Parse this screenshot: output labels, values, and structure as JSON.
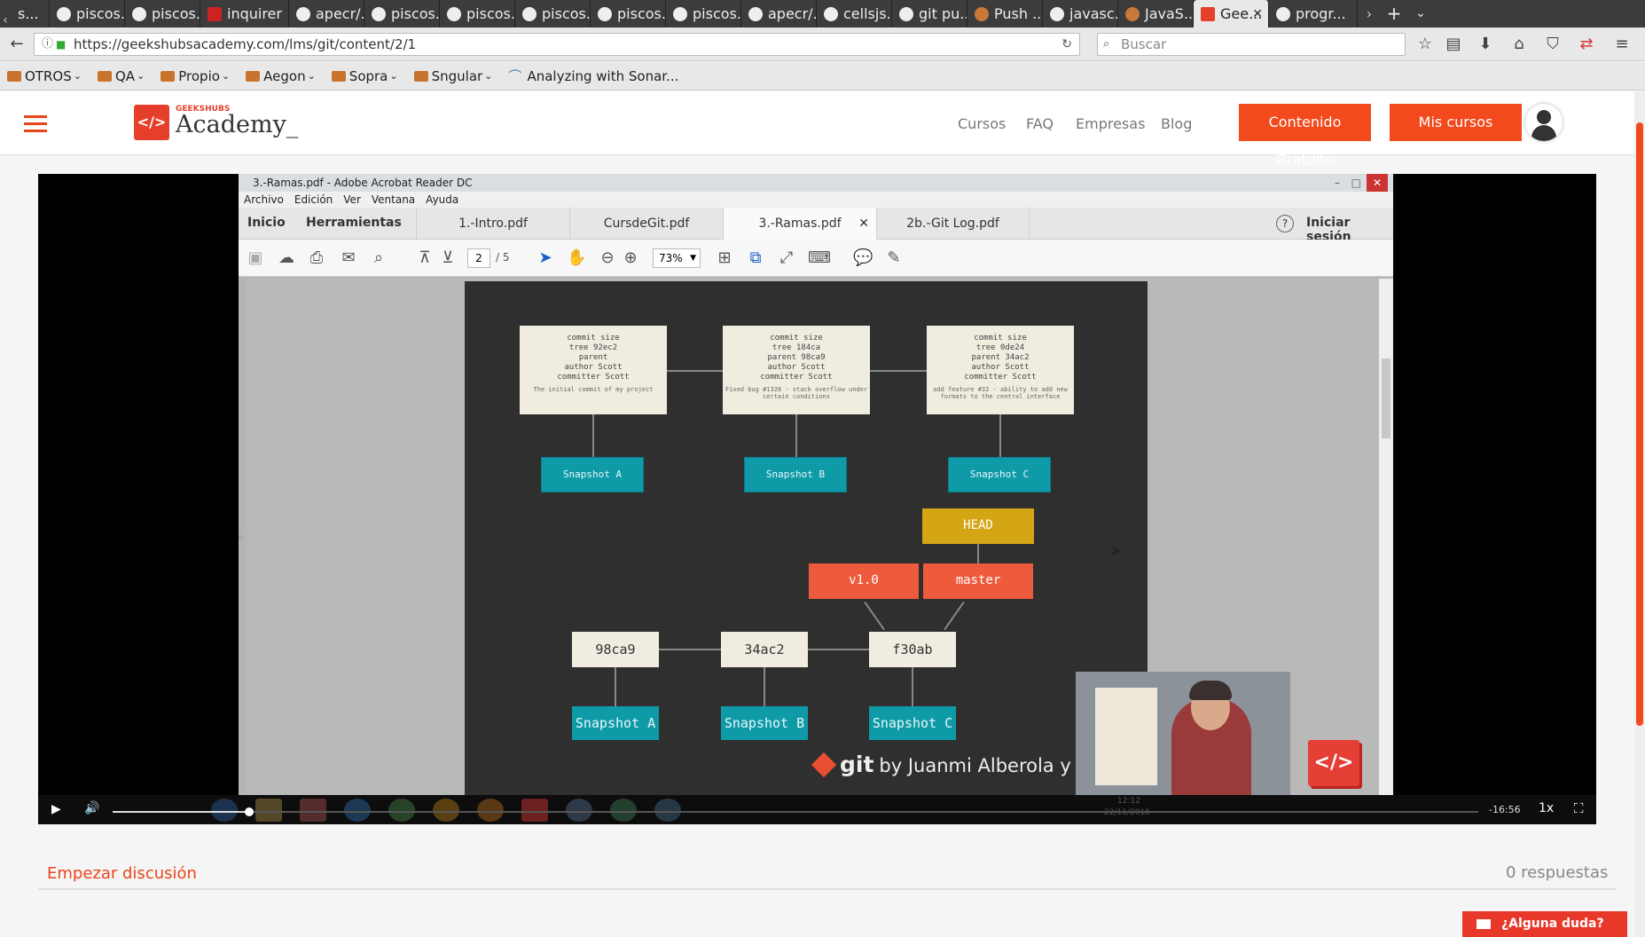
{
  "browser": {
    "tabs": [
      {
        "label": "s..."
      },
      {
        "label": "piscos..."
      },
      {
        "label": "piscos..."
      },
      {
        "label": "inquirer"
      },
      {
        "label": "apecr/..."
      },
      {
        "label": "piscos..."
      },
      {
        "label": "piscos..."
      },
      {
        "label": "piscos..."
      },
      {
        "label": "piscos..."
      },
      {
        "label": "piscos..."
      },
      {
        "label": "apecr/..."
      },
      {
        "label": "cellsjs..."
      },
      {
        "label": "git pu..."
      },
      {
        "label": "Push ..."
      },
      {
        "label": "javasc..."
      },
      {
        "label": "JavaS..."
      },
      {
        "label": "Gee..."
      },
      {
        "label": "progr..."
      }
    ],
    "url": "https://geekshubsacademy.com/lms/git/content/2/1",
    "search_placeholder": "Buscar",
    "bookmarks": [
      {
        "label": "OTROS"
      },
      {
        "label": "QA"
      },
      {
        "label": "Propio"
      },
      {
        "label": "Aegon"
      },
      {
        "label": "Sopra"
      },
      {
        "label": "Sngular"
      },
      {
        "label": "Analyzing with Sonar..."
      }
    ]
  },
  "site": {
    "logo_small": "GEEKSHUBS",
    "logo_text": "Academy_",
    "logo_mark": "</>",
    "nav": [
      {
        "label": "Cursos"
      },
      {
        "label": "FAQ"
      },
      {
        "label": "Empresas"
      },
      {
        "label": "Blog"
      }
    ],
    "btn_free": "Contenido Gratuito",
    "btn_courses": "Mis cursos"
  },
  "acrobat": {
    "title": "3.-Ramas.pdf - Adobe Acrobat Reader DC",
    "menu": [
      {
        "label": "Archivo"
      },
      {
        "label": "Edición"
      },
      {
        "label": "Ver"
      },
      {
        "label": "Ventana"
      },
      {
        "label": "Ayuda"
      }
    ],
    "home": "Inicio",
    "tools": "Herramientas",
    "doc_tabs": [
      {
        "label": "1.-Intro.pdf"
      },
      {
        "label": "CursdeGit.pdf"
      },
      {
        "label": "3.-Ramas.pdf"
      },
      {
        "label": "2b.-Git Log.pdf"
      }
    ],
    "signin": "Iniciar sesión",
    "page_current": "2",
    "page_total": "/ 5",
    "zoom": "73%"
  },
  "slide": {
    "commits": [
      {
        "rows": [
          "commit  size",
          "tree  92ec2",
          "parent",
          "author  Scott",
          "committer  Scott"
        ],
        "msg": "The initial commit of my project"
      },
      {
        "rows": [
          "commit  size",
          "tree  184ca",
          "parent  98ca9",
          "author  Scott",
          "committer  Scott"
        ],
        "msg": "Fixed bug #1328 - stack overflow under certain conditions"
      },
      {
        "rows": [
          "commit  size",
          "tree  0de24",
          "parent  34ac2",
          "author  Scott",
          "committer  Scott"
        ],
        "msg": "add feature #32 - ability to add new formats to the central interface"
      }
    ],
    "snapshots_top": [
      "Snapshot A",
      "Snapshot B",
      "Snapshot C"
    ],
    "head": "HEAD",
    "tag": "v1.0",
    "branch": "master",
    "shas": [
      "98ca9",
      "34ac2",
      "f30ab"
    ],
    "snapshots_bottom": [
      "Snapshot A",
      "Snapshot B",
      "Snapshot C"
    ],
    "footer_git": "git",
    "footer_by": "by Juanmi Alberola y Pac"
  },
  "player": {
    "progress": 0.1,
    "time_remaining": "-16:56",
    "speed": "1x",
    "clock": "12:12",
    "date": "22/11/2016"
  },
  "discussion": {
    "start_label": "Empezar discusión",
    "responses": "0 respuestas"
  },
  "help": {
    "label": "¿Alguna duda?"
  },
  "colors": {
    "brand": "#f24a1c",
    "teal": "#0f9aa8",
    "head": "#d4a514",
    "ref": "#ee5a3c"
  }
}
